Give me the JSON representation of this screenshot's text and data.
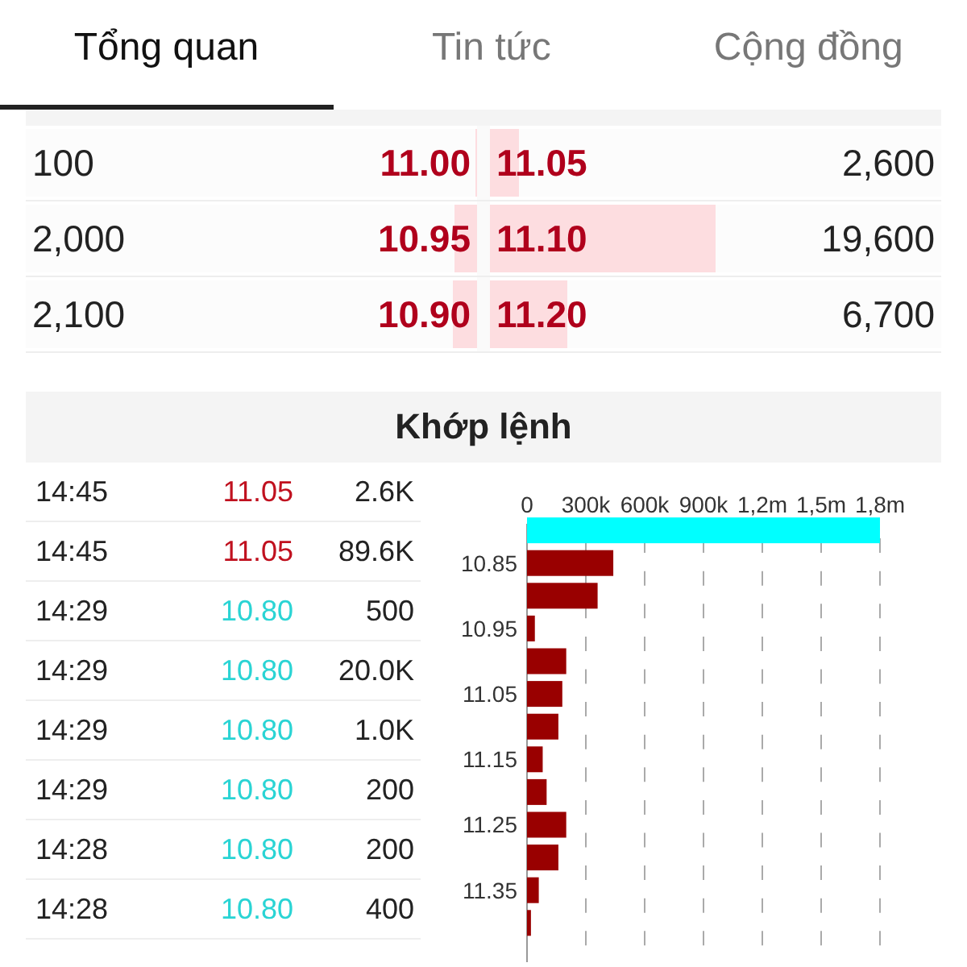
{
  "tabs": [
    {
      "label": "Tổng quan",
      "selected": true
    },
    {
      "label": "Tin tức",
      "selected": false
    },
    {
      "label": "Cộng đồng",
      "selected": false
    }
  ],
  "order_book": [
    {
      "bid": {
        "volume": "100",
        "price": "11.00",
        "level": 0.004
      },
      "ask": {
        "price": "11.05",
        "level": 0.065,
        "volume": "2,600"
      }
    },
    {
      "bid": {
        "volume": "2,000",
        "price": "10.95",
        "level": 0.05
      },
      "ask": {
        "price": "11.10",
        "level": 0.5,
        "volume": "19,600"
      }
    },
    {
      "bid": {
        "volume": "2,100",
        "price": "10.90",
        "level": 0.054
      },
      "ask": {
        "price": "11.20",
        "level": 0.17,
        "volume": "6,700"
      }
    }
  ],
  "matched_section": {
    "title": "Khớp lệnh",
    "trades": [
      {
        "time": "14:45",
        "price": "11.05",
        "volume": "2.6K",
        "color": "#c0111f"
      },
      {
        "time": "14:45",
        "price": "11.05",
        "volume": "89.6K",
        "color": "#c0111f"
      },
      {
        "time": "14:29",
        "price": "10.80",
        "volume": "500",
        "color": "#2ad4d4"
      },
      {
        "time": "14:29",
        "price": "10.80",
        "volume": "20.0K",
        "color": "#2ad4d4"
      },
      {
        "time": "14:29",
        "price": "10.80",
        "volume": "1.0K",
        "color": "#2ad4d4"
      },
      {
        "time": "14:29",
        "price": "10.80",
        "volume": "200",
        "color": "#2ad4d4"
      },
      {
        "time": "14:28",
        "price": "10.80",
        "volume": "200",
        "color": "#2ad4d4"
      },
      {
        "time": "14:28",
        "price": "10.80",
        "volume": "400",
        "color": "#2ad4d4"
      }
    ],
    "chart_data": {
      "type": "bar",
      "orientation": "horizontal",
      "x": [
        10.8,
        10.85,
        10.9,
        10.95,
        11.0,
        11.05,
        11.1,
        11.15,
        11.2,
        11.25,
        11.3,
        11.35,
        11.4
      ],
      "series": [
        {
          "color": "#00ffff",
          "values": [
            1800000,
            null,
            null,
            null,
            null,
            null,
            null,
            null,
            null,
            null,
            null,
            null,
            null
          ]
        },
        {
          "color": "#990000",
          "values": [
            null,
            440000,
            360000,
            40000,
            200000,
            180000,
            160000,
            80000,
            100000,
            200000,
            160000,
            60000,
            20000
          ]
        }
      ],
      "stacked": true,
      "grid": true,
      "ylim": [
        11.46,
        10.79
      ],
      "yticks": [
        10.85,
        10.95,
        11.05,
        11.15,
        11.25,
        11.35
      ],
      "xlim": [
        0,
        1800000
      ],
      "xticks": [
        {
          "value": 0,
          "label": "0"
        },
        {
          "value": 300000,
          "label": "300k"
        },
        {
          "value": 600000,
          "label": "600k"
        },
        {
          "value": 900000,
          "label": "900k"
        },
        {
          "value": 1200000,
          "label": "1,2m"
        },
        {
          "value": 1500000,
          "label": "1,5m"
        },
        {
          "value": 1800000,
          "label": "1,8m"
        }
      ]
    }
  }
}
